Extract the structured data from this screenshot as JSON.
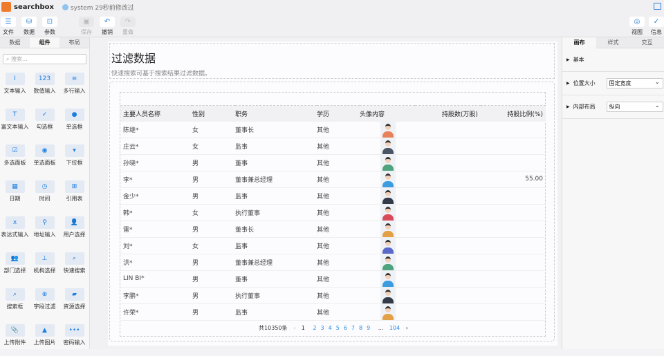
{
  "app": {
    "name": "searchbox",
    "saved_status": "system 29秒前修改过"
  },
  "toolbar": {
    "file": "文件",
    "data": "数据",
    "params": "参数",
    "save": "保存",
    "undo": "撤销",
    "redo": "重做",
    "view": "视图",
    "info": "信息"
  },
  "left": {
    "tabs": [
      "数据",
      "组件",
      "布局"
    ],
    "search_placeholder": "搜索...",
    "components": [
      {
        "label": "文本输入",
        "icon": "I"
      },
      {
        "label": "数值输入",
        "icon": "123"
      },
      {
        "label": "多行输入",
        "icon": "≡"
      },
      {
        "label": "富文本输入",
        "icon": "T"
      },
      {
        "label": "勾选框",
        "icon": "✓"
      },
      {
        "label": "单选框",
        "icon": "●"
      },
      {
        "label": "多选面板",
        "icon": "☑"
      },
      {
        "label": "单选面板",
        "icon": "◉"
      },
      {
        "label": "下拉框",
        "icon": "▾"
      },
      {
        "label": "日期",
        "icon": "▦"
      },
      {
        "label": "时间",
        "icon": "◷"
      },
      {
        "label": "引用表",
        "icon": "⊞"
      },
      {
        "label": "表达式输入",
        "icon": "x"
      },
      {
        "label": "地址输入",
        "icon": "⚲"
      },
      {
        "label": "用户选择",
        "icon": "👤"
      },
      {
        "label": "部门选择",
        "icon": "👥"
      },
      {
        "label": "机构选择",
        "icon": "⊥"
      },
      {
        "label": "快速搜索",
        "icon": "⌕"
      },
      {
        "label": "搜索框",
        "icon": "⌕"
      },
      {
        "label": "字段过滤",
        "icon": "⊕"
      },
      {
        "label": "资源选择",
        "icon": "▰"
      },
      {
        "label": "上传附件",
        "icon": "📎"
      },
      {
        "label": "上传图片",
        "icon": "▲"
      },
      {
        "label": "密码输入",
        "icon": "•••"
      }
    ]
  },
  "main": {
    "title": "过滤数据",
    "subtitle": "快速搜索可基于搜索结果过滤数据。",
    "table": {
      "columns": [
        "主要人员名称",
        "性别",
        "职务",
        "学历",
        "头像内容",
        "持股数(万股)",
        "持股比例(%)"
      ],
      "rows": [
        {
          "name": "陈继*",
          "gender": "女",
          "title": "董事长",
          "edu": "其他",
          "shares": "",
          "ratio": "",
          "avatar": "#e8805c"
        },
        {
          "name": "庄云*",
          "gender": "女",
          "title": "监事",
          "edu": "其他",
          "shares": "",
          "ratio": "",
          "avatar": "#4a5566"
        },
        {
          "name": "孙晓*",
          "gender": "男",
          "title": "董事",
          "edu": "其他",
          "shares": "",
          "ratio": "",
          "avatar": "#4fa37f"
        },
        {
          "name": "李*",
          "gender": "男",
          "title": "董事兼总经理",
          "edu": "其他",
          "shares": "",
          "ratio": "55.00",
          "avatar": "#3d9be0"
        },
        {
          "name": "金少*",
          "gender": "男",
          "title": "监事",
          "edu": "其他",
          "shares": "",
          "ratio": "",
          "avatar": "#333a48"
        },
        {
          "name": "韩*",
          "gender": "女",
          "title": "执行董事",
          "edu": "其他",
          "shares": "",
          "ratio": "",
          "avatar": "#d84a5a"
        },
        {
          "name": "雷*",
          "gender": "男",
          "title": "董事长",
          "edu": "其他",
          "shares": "",
          "ratio": "",
          "avatar": "#e3a044"
        },
        {
          "name": "刘*",
          "gender": "女",
          "title": "监事",
          "edu": "其他",
          "shares": "",
          "ratio": "",
          "avatar": "#5a68c8"
        },
        {
          "name": "洪*",
          "gender": "男",
          "title": "董事兼总经理",
          "edu": "其他",
          "shares": "",
          "ratio": "",
          "avatar": "#4fa37f"
        },
        {
          "name": "LIN BI*",
          "gender": "男",
          "title": "董事",
          "edu": "其他",
          "shares": "",
          "ratio": "",
          "avatar": "#3d9be0"
        },
        {
          "name": "李鹏*",
          "gender": "男",
          "title": "执行董事",
          "edu": "其他",
          "shares": "",
          "ratio": "",
          "avatar": "#333a48"
        },
        {
          "name": "许荣*",
          "gender": "男",
          "title": "监事",
          "edu": "其他",
          "shares": "",
          "ratio": "",
          "avatar": "#e3a044"
        }
      ]
    },
    "pager": {
      "total": "共10350条",
      "current": "1",
      "pages": [
        "2",
        "3",
        "4",
        "5",
        "6",
        "7",
        "8",
        "9"
      ],
      "ellipsis": "...",
      "last": "104"
    }
  },
  "right": {
    "tabs": [
      "画布",
      "样式",
      "交互"
    ],
    "sections": [
      {
        "label": "基本",
        "value": null
      },
      {
        "label": "位置大小",
        "value": "固定宽度"
      },
      {
        "label": "内部布局",
        "value": "纵向"
      }
    ]
  }
}
